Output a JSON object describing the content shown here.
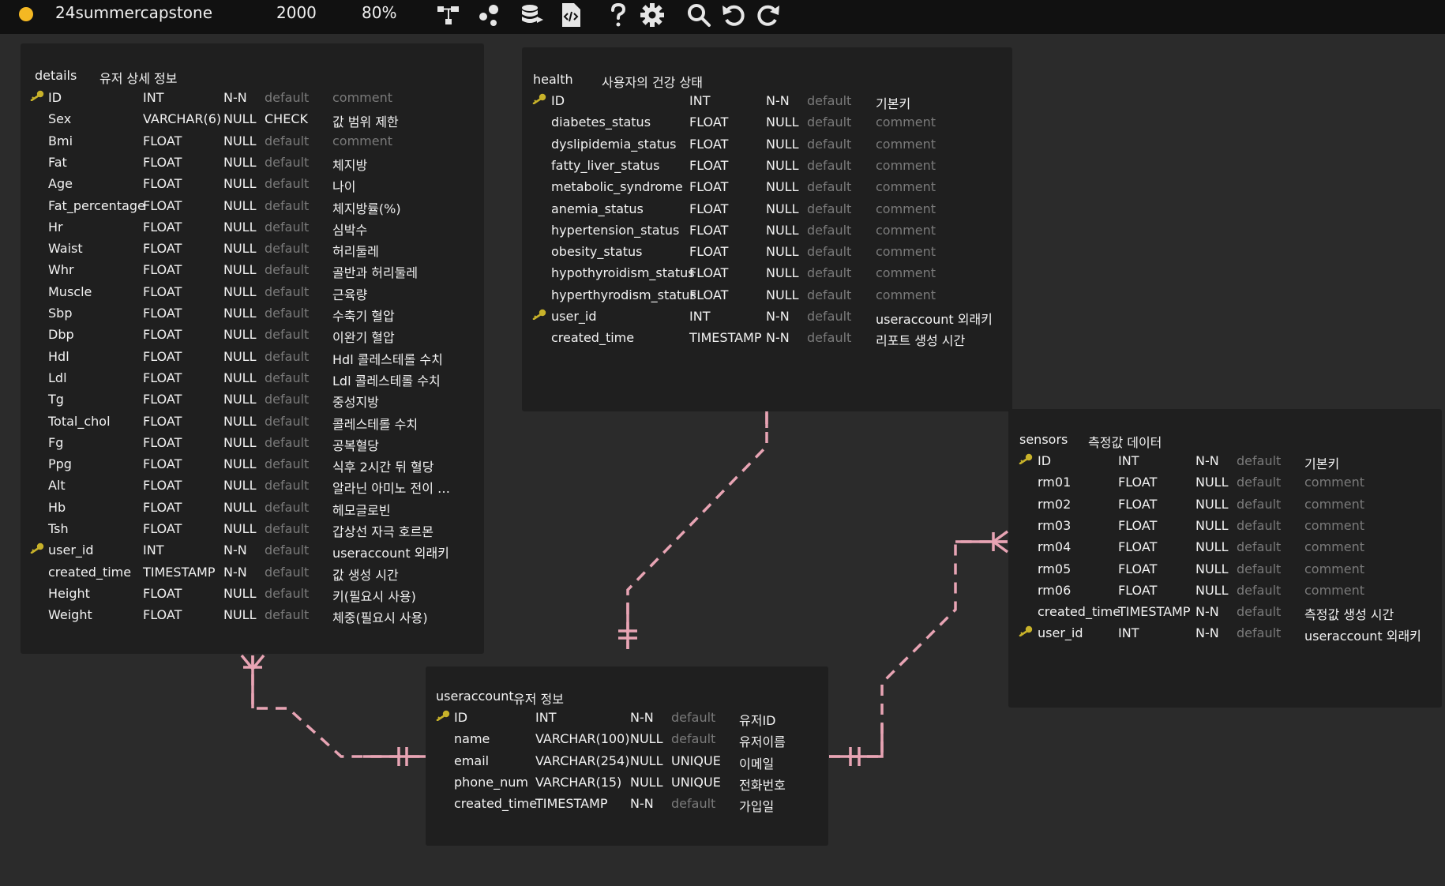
{
  "toolbar": {
    "project_name": "24summercapstone",
    "canvas_size": "2000",
    "zoom": "80%",
    "icons": [
      "relationship-icon",
      "share-nodes-icon",
      "database-icon",
      "code-file-icon",
      "help-icon",
      "settings-icon",
      "search-icon",
      "undo-icon",
      "redo-icon"
    ],
    "dot_color": "#f4b823"
  },
  "colors": {
    "relation_line": "#e8a4b4",
    "key_icon": "#c8b22a"
  },
  "tables": [
    {
      "id": "details",
      "name": "details",
      "comment": "유저 상세 정보",
      "columns": [
        {
          "name": "ID",
          "type": "INT",
          "null": "N-N",
          "default": "default",
          "comment": "comment",
          "key": true,
          "default_muted": true,
          "comment_muted": true
        },
        {
          "name": "Sex",
          "type": "VARCHAR(6)",
          "null": "NULL",
          "default": "CHECK",
          "comment": "값 범위 제한",
          "key": false,
          "default_muted": false,
          "comment_muted": false
        },
        {
          "name": "Bmi",
          "type": "FLOAT",
          "null": "NULL",
          "default": "default",
          "comment": "comment",
          "key": false,
          "default_muted": true,
          "comment_muted": true
        },
        {
          "name": "Fat",
          "type": "FLOAT",
          "null": "NULL",
          "default": "default",
          "comment": "체지방",
          "key": false,
          "default_muted": true,
          "comment_muted": false
        },
        {
          "name": "Age",
          "type": "FLOAT",
          "null": "NULL",
          "default": "default",
          "comment": "나이",
          "key": false,
          "default_muted": true,
          "comment_muted": false
        },
        {
          "name": "Fat_percentage",
          "type": "FLOAT",
          "null": "NULL",
          "default": "default",
          "comment": "체지방률(%)",
          "key": false,
          "default_muted": true,
          "comment_muted": false
        },
        {
          "name": "Hr",
          "type": "FLOAT",
          "null": "NULL",
          "default": "default",
          "comment": "심박수",
          "key": false,
          "default_muted": true,
          "comment_muted": false
        },
        {
          "name": "Waist",
          "type": "FLOAT",
          "null": "NULL",
          "default": "default",
          "comment": "허리둘레",
          "key": false,
          "default_muted": true,
          "comment_muted": false
        },
        {
          "name": "Whr",
          "type": "FLOAT",
          "null": "NULL",
          "default": "default",
          "comment": "골반과 허리둘레",
          "key": false,
          "default_muted": true,
          "comment_muted": false
        },
        {
          "name": "Muscle",
          "type": "FLOAT",
          "null": "NULL",
          "default": "default",
          "comment": "근육량",
          "key": false,
          "default_muted": true,
          "comment_muted": false
        },
        {
          "name": "Sbp",
          "type": "FLOAT",
          "null": "NULL",
          "default": "default",
          "comment": "수축기 혈압",
          "key": false,
          "default_muted": true,
          "comment_muted": false
        },
        {
          "name": "Dbp",
          "type": "FLOAT",
          "null": "NULL",
          "default": "default",
          "comment": "이완기 혈압",
          "key": false,
          "default_muted": true,
          "comment_muted": false
        },
        {
          "name": "Hdl",
          "type": "FLOAT",
          "null": "NULL",
          "default": "default",
          "comment": "Hdl 콜레스테롤 수치",
          "key": false,
          "default_muted": true,
          "comment_muted": false
        },
        {
          "name": "Ldl",
          "type": "FLOAT",
          "null": "NULL",
          "default": "default",
          "comment": "Ldl 콜레스테롤 수치",
          "key": false,
          "default_muted": true,
          "comment_muted": false
        },
        {
          "name": "Tg",
          "type": "FLOAT",
          "null": "NULL",
          "default": "default",
          "comment": "중성지방",
          "key": false,
          "default_muted": true,
          "comment_muted": false
        },
        {
          "name": "Total_chol",
          "type": "FLOAT",
          "null": "NULL",
          "default": "default",
          "comment": "콜레스테롤 수치",
          "key": false,
          "default_muted": true,
          "comment_muted": false
        },
        {
          "name": "Fg",
          "type": "FLOAT",
          "null": "NULL",
          "default": "default",
          "comment": "공복혈당",
          "key": false,
          "default_muted": true,
          "comment_muted": false
        },
        {
          "name": "Ppg",
          "type": "FLOAT",
          "null": "NULL",
          "default": "default",
          "comment": "식후 2시간 뒤 혈당",
          "key": false,
          "default_muted": true,
          "comment_muted": false
        },
        {
          "name": "Alt",
          "type": "FLOAT",
          "null": "NULL",
          "default": "default",
          "comment": "알라닌 아미노 전이 …",
          "key": false,
          "default_muted": true,
          "comment_muted": false
        },
        {
          "name": "Hb",
          "type": "FLOAT",
          "null": "NULL",
          "default": "default",
          "comment": "헤모글로빈",
          "key": false,
          "default_muted": true,
          "comment_muted": false
        },
        {
          "name": "Tsh",
          "type": "FLOAT",
          "null": "NULL",
          "default": "default",
          "comment": "갑상선 자극 호르몬",
          "key": false,
          "default_muted": true,
          "comment_muted": false
        },
        {
          "name": "user_id",
          "type": "INT",
          "null": "N-N",
          "default": "default",
          "comment": "useraccount 외래키",
          "key": true,
          "default_muted": true,
          "comment_muted": false
        },
        {
          "name": "created_time",
          "type": "TIMESTAMP",
          "null": "N-N",
          "default": "default",
          "comment": "값 생성 시간",
          "key": false,
          "default_muted": true,
          "comment_muted": false
        },
        {
          "name": "Height",
          "type": "FLOAT",
          "null": "NULL",
          "default": "default",
          "comment": "키(필요시 사용)",
          "key": false,
          "default_muted": true,
          "comment_muted": false
        },
        {
          "name": "Weight",
          "type": "FLOAT",
          "null": "NULL",
          "default": "default",
          "comment": "체중(필요시 사용)",
          "key": false,
          "default_muted": true,
          "comment_muted": false
        }
      ]
    },
    {
      "id": "health",
      "name": "health",
      "comment": "사용자의 건강 상태",
      "columns": [
        {
          "name": "ID",
          "type": "INT",
          "null": "N-N",
          "default": "default",
          "comment": "기본키",
          "key": true,
          "default_muted": true,
          "comment_muted": false
        },
        {
          "name": "diabetes_status",
          "type": "FLOAT",
          "null": "NULL",
          "default": "default",
          "comment": "comment",
          "key": false,
          "default_muted": true,
          "comment_muted": true
        },
        {
          "name": "dyslipidemia_status",
          "type": "FLOAT",
          "null": "NULL",
          "default": "default",
          "comment": "comment",
          "key": false,
          "default_muted": true,
          "comment_muted": true
        },
        {
          "name": "fatty_liver_status",
          "type": "FLOAT",
          "null": "NULL",
          "default": "default",
          "comment": "comment",
          "key": false,
          "default_muted": true,
          "comment_muted": true
        },
        {
          "name": "metabolic_syndrome",
          "type": "FLOAT",
          "null": "NULL",
          "default": "default",
          "comment": "comment",
          "key": false,
          "default_muted": true,
          "comment_muted": true
        },
        {
          "name": "anemia_status",
          "type": "FLOAT",
          "null": "NULL",
          "default": "default",
          "comment": "comment",
          "key": false,
          "default_muted": true,
          "comment_muted": true
        },
        {
          "name": "hypertension_status",
          "type": "FLOAT",
          "null": "NULL",
          "default": "default",
          "comment": "comment",
          "key": false,
          "default_muted": true,
          "comment_muted": true
        },
        {
          "name": "obesity_status",
          "type": "FLOAT",
          "null": "NULL",
          "default": "default",
          "comment": "comment",
          "key": false,
          "default_muted": true,
          "comment_muted": true
        },
        {
          "name": "hypothyroidism_status",
          "type": "FLOAT",
          "null": "NULL",
          "default": "default",
          "comment": "comment",
          "key": false,
          "default_muted": true,
          "comment_muted": true
        },
        {
          "name": "hyperthyrodism_status",
          "type": "FLOAT",
          "null": "NULL",
          "default": "default",
          "comment": "comment",
          "key": false,
          "default_muted": true,
          "comment_muted": true
        },
        {
          "name": "user_id",
          "type": "INT",
          "null": "N-N",
          "default": "default",
          "comment": "useraccount 외래키",
          "key": true,
          "default_muted": true,
          "comment_muted": false
        },
        {
          "name": "created_time",
          "type": "TIMESTAMP",
          "null": "N-N",
          "default": "default",
          "comment": "리포트 생성 시간",
          "key": false,
          "default_muted": true,
          "comment_muted": false
        }
      ]
    },
    {
      "id": "sensors",
      "name": "sensors",
      "comment": "측정값 데이터",
      "columns": [
        {
          "name": "ID",
          "type": "INT",
          "null": "N-N",
          "default": "default",
          "comment": "기본키",
          "key": true,
          "default_muted": true,
          "comment_muted": false
        },
        {
          "name": "rm01",
          "type": "FLOAT",
          "null": "NULL",
          "default": "default",
          "comment": "comment",
          "key": false,
          "default_muted": true,
          "comment_muted": true
        },
        {
          "name": "rm02",
          "type": "FLOAT",
          "null": "NULL",
          "default": "default",
          "comment": "comment",
          "key": false,
          "default_muted": true,
          "comment_muted": true
        },
        {
          "name": "rm03",
          "type": "FLOAT",
          "null": "NULL",
          "default": "default",
          "comment": "comment",
          "key": false,
          "default_muted": true,
          "comment_muted": true
        },
        {
          "name": "rm04",
          "type": "FLOAT",
          "null": "NULL",
          "default": "default",
          "comment": "comment",
          "key": false,
          "default_muted": true,
          "comment_muted": true
        },
        {
          "name": "rm05",
          "type": "FLOAT",
          "null": "NULL",
          "default": "default",
          "comment": "comment",
          "key": false,
          "default_muted": true,
          "comment_muted": true
        },
        {
          "name": "rm06",
          "type": "FLOAT",
          "null": "NULL",
          "default": "default",
          "comment": "comment",
          "key": false,
          "default_muted": true,
          "comment_muted": true
        },
        {
          "name": "created_time",
          "type": "TIMESTAMP",
          "null": "N-N",
          "default": "default",
          "comment": "측정값 생성 시간",
          "key": false,
          "default_muted": true,
          "comment_muted": false
        },
        {
          "name": "user_id",
          "type": "INT",
          "null": "N-N",
          "default": "default",
          "comment": "useraccount 외래키",
          "key": true,
          "default_muted": true,
          "comment_muted": false
        }
      ]
    },
    {
      "id": "useraccount",
      "name": "useraccount",
      "comment": "유저 정보",
      "columns": [
        {
          "name": "ID",
          "type": "INT",
          "null": "N-N",
          "default": "default",
          "comment": "유저ID",
          "key": true,
          "default_muted": true,
          "comment_muted": false
        },
        {
          "name": "name",
          "type": "VARCHAR(100)",
          "null": "NULL",
          "default": "default",
          "comment": "유저이름",
          "key": false,
          "default_muted": true,
          "comment_muted": false
        },
        {
          "name": "email",
          "type": "VARCHAR(254)",
          "null": "NULL",
          "default": "UNIQUE",
          "comment": "이메일",
          "key": false,
          "default_muted": false,
          "comment_muted": false
        },
        {
          "name": "phone_num",
          "type": "VARCHAR(15)",
          "null": "NULL",
          "default": "UNIQUE",
          "comment": "전화번호",
          "key": false,
          "default_muted": false,
          "comment_muted": false
        },
        {
          "name": "created_time",
          "type": "TIMESTAMP",
          "null": "N-N",
          "default": "default",
          "comment": "가입일",
          "key": false,
          "default_muted": true,
          "comment_muted": false
        }
      ]
    }
  ]
}
